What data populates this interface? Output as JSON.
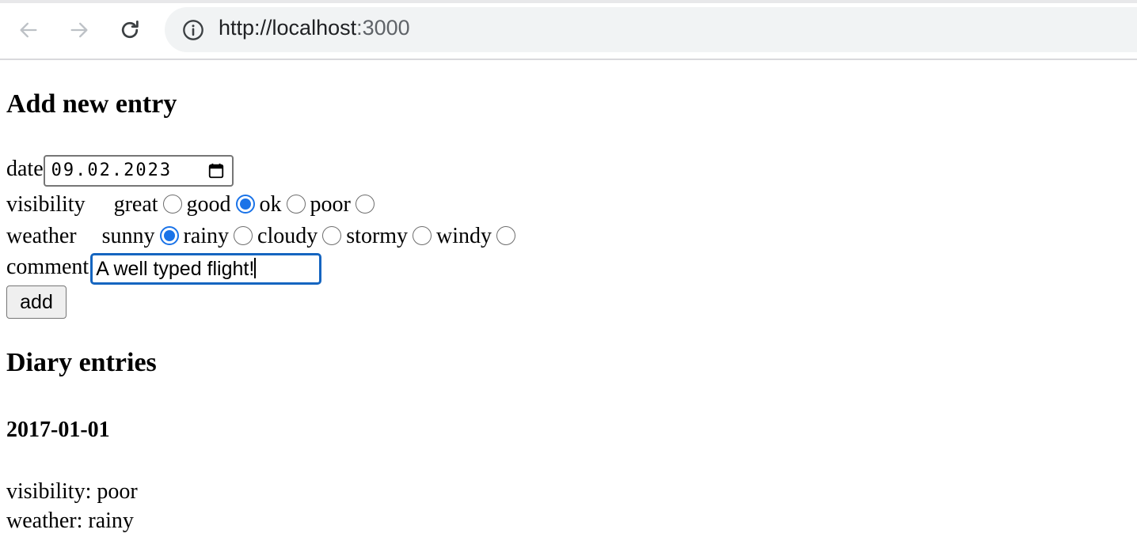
{
  "browser": {
    "url_host": "http://localhost",
    "url_port": ":3000"
  },
  "form": {
    "heading": "Add new entry",
    "date_label": "date",
    "date_value": "09.02.2023",
    "visibility_label": "visibility",
    "visibility_options": [
      "great",
      "good",
      "ok",
      "poor"
    ],
    "visibility_selected": "good",
    "weather_label": "weather",
    "weather_options": [
      "sunny",
      "rainy",
      "cloudy",
      "stormy",
      "windy"
    ],
    "weather_selected": "sunny",
    "comment_label": "comment",
    "comment_value": "A well typed flight!",
    "add_label": "add"
  },
  "entries": {
    "heading": "Diary entries",
    "items": [
      {
        "date": "2017-01-01",
        "visibility_text": "visibility: poor",
        "weather_text": "weather: rainy"
      }
    ]
  }
}
